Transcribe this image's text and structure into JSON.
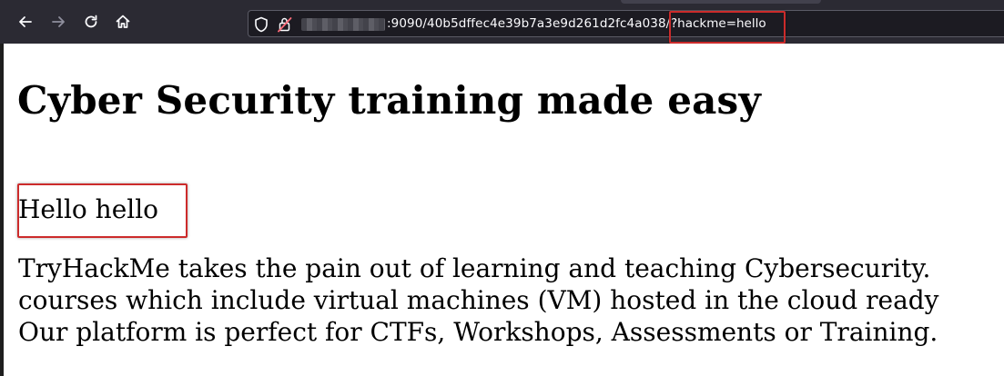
{
  "browser": {
    "url_host_masked": true,
    "url_path": ":9090/40b5dffec4e39b7a3e9d261d2fc4a038/",
    "url_query": "?hackme=hello",
    "icons": [
      "back-arrow-icon",
      "forward-arrow-icon",
      "reload-icon",
      "home-icon",
      "shield-icon",
      "lock-warning-icon"
    ]
  },
  "page": {
    "heading": "Cyber Security training made easy",
    "greeting": "Hello hello",
    "paragraph_lines": [
      "TryHackMe takes the pain out of learning and teaching Cybersecurity.",
      "courses which include virtual machines (VM) hosted in the cloud ready",
      "Our platform is perfect for CTFs, Workshops, Assessments or Training."
    ]
  },
  "colors": {
    "toolbar_bg": "#2b2a33",
    "urlbar_bg": "#1c1b22",
    "highlight_box": "#cc2b2b",
    "lock_warning": "#ff6b7a"
  }
}
